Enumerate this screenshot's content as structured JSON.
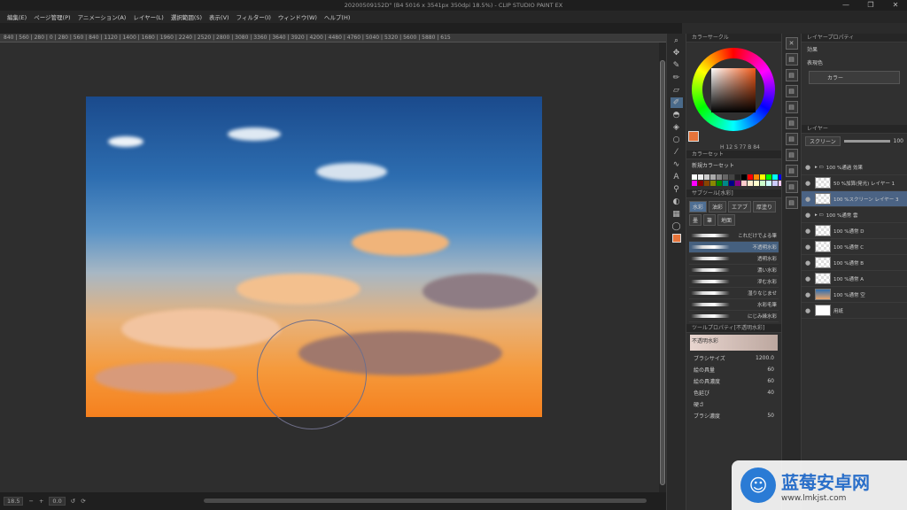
{
  "window": {
    "title": "20200509152D\" (B4 5016 x 3541px 350dpi 18.5%) - CLIP STUDIO PAINT EX",
    "controls": [
      "—",
      "❐",
      "✕"
    ]
  },
  "menu": [
    "編集(E)",
    "ページ管理(P)",
    "アニメーション(A)",
    "レイヤー(L)",
    "選択範囲(S)",
    "表示(V)",
    "フィルター(I)",
    "ウィンドウ(W)",
    "ヘルプ(H)"
  ],
  "ruler": "840 | 560 | 280 | 0 | 280 | 560 | 840 | 1120 | 1400 | 1680 | 1960 | 2240 | 2520 | 2800 | 3080 | 3360 | 3640 | 3920 | 4200 | 4480 | 4760 | 5040 | 5320 | 5600 | 5880 | 615",
  "status": {
    "zoom": "18.5",
    "angle": "0.0"
  },
  "color_wheel": {
    "panel_title": "カラーサークル",
    "rgb": "H 12  S 77  B 84",
    "current_color": "#e7743a"
  },
  "color_set": {
    "panel_title": "カラーセット",
    "set_name": "新規カラーセット"
  },
  "subtool": {
    "panel_title": "サブツール[水彩]",
    "tabs": [
      "水彩",
      "油彩",
      "エアブ",
      "厚塗り",
      "墨",
      "筆",
      "地面"
    ],
    "brushes": [
      "これだけでよる筆",
      "不透明水彩",
      "透明水彩",
      "濃い水彩",
      "滲む水彩",
      "湿りなじませ",
      "水彩毛筆",
      "にじみ縁水彩"
    ],
    "active_brush": "不透明水彩"
  },
  "tool_property": {
    "panel_title": "ツールプロパティ[不透明水彩]",
    "preview_label": "不透明水彩",
    "rows": [
      {
        "label": "ブラシサイズ",
        "value": "1200.0"
      },
      {
        "label": "絵の具量",
        "value": "60"
      },
      {
        "label": "絵の具濃度",
        "value": "60"
      },
      {
        "label": "色延び",
        "value": "40"
      },
      {
        "label": "硬さ",
        "value": ""
      },
      {
        "label": "ブラシ濃度",
        "value": "50"
      }
    ]
  },
  "layer_property": {
    "panel_title": "レイヤープロパティ",
    "effect_label": "効果",
    "expression_label": "表現色",
    "expression_value": "カラー"
  },
  "layers": {
    "panel_title": "レイヤー",
    "blend_mode": "スクリーン",
    "opacity": "100",
    "items": [
      {
        "name": "100 %通過 効果",
        "type": "folder",
        "thumb": "none",
        "active": false
      },
      {
        "name": "50 %加算(発光) レイヤー 1",
        "type": "layer",
        "thumb": "check",
        "active": false
      },
      {
        "name": "100 %スクリーン レイヤー 3",
        "type": "layer",
        "thumb": "check",
        "active": true
      },
      {
        "name": "100 %通常 雲",
        "type": "folder",
        "thumb": "none",
        "active": false
      },
      {
        "name": "100 %通常 D",
        "type": "layer",
        "thumb": "check",
        "active": false
      },
      {
        "name": "100 %通常 C",
        "type": "layer",
        "thumb": "check",
        "active": false
      },
      {
        "name": "100 %通常 B",
        "type": "layer",
        "thumb": "check",
        "active": false
      },
      {
        "name": "100 %通常 A",
        "type": "layer",
        "thumb": "check",
        "active": false
      },
      {
        "name": "100 %通常 空",
        "type": "layer",
        "thumb": "sky",
        "active": false
      },
      {
        "name": "用紙",
        "type": "paper",
        "thumb": "white",
        "active": false
      }
    ]
  },
  "watermark": {
    "title": "蓝莓安卓网",
    "url": "www.lmkjst.com"
  }
}
